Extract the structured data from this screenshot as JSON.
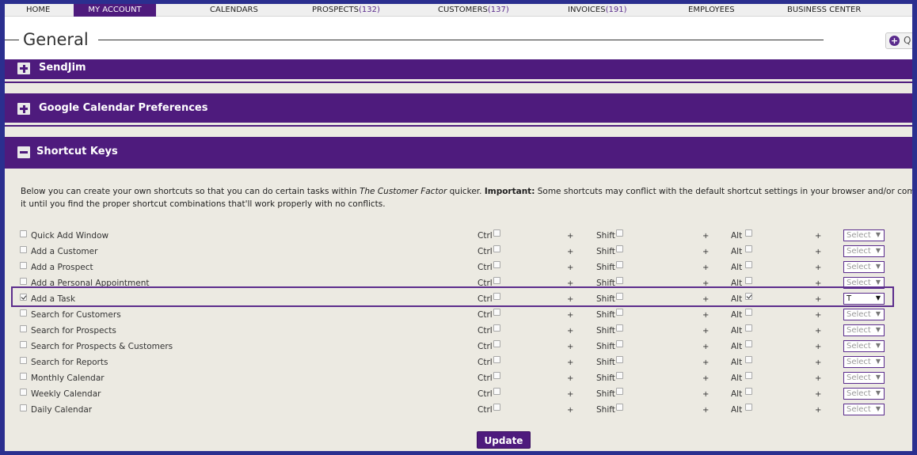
{
  "nav": {
    "home": "HOME",
    "my_account": "MY ACCOUNT",
    "calendars": "CALENDARS",
    "prospects": "PROSPECTS",
    "prospects_count": "(132)",
    "customers": "CUSTOMERS",
    "customers_count": "(137)",
    "invoices": "INVOICES",
    "invoices_count": "(191)",
    "employees": "EMPLOYEES",
    "business_center": "BUSINESS CENTER"
  },
  "header": {
    "title": "General",
    "quick_button_label": "Q"
  },
  "sections": {
    "sendjim": "SendJim",
    "google_calendar": "Google Calendar Preferences",
    "shortcut_keys": "Shortcut Keys"
  },
  "description": {
    "part1": "Below you can create your own shortcuts so that you can do certain tasks within ",
    "brand": "The Customer Factor",
    "part2": " quicker. ",
    "important_label": "Important:",
    "part3": " Some shortcuts may conflict with the default shortcut settings in your browser and/or computer, so it may be nece",
    "line2": "it until you find the proper shortcut combinations that'll work properly with no conflicts."
  },
  "modifiers": {
    "ctrl": "Ctrl",
    "shift": "Shift",
    "alt": "Alt",
    "plus": "+"
  },
  "shortcuts": [
    {
      "label": "Quick Add Window",
      "enabled": false,
      "ctrl": false,
      "shift": false,
      "alt": false,
      "key": "Select"
    },
    {
      "label": "Add a Customer",
      "enabled": false,
      "ctrl": false,
      "shift": false,
      "alt": false,
      "key": "Select"
    },
    {
      "label": "Add a Prospect",
      "enabled": false,
      "ctrl": false,
      "shift": false,
      "alt": false,
      "key": "Select"
    },
    {
      "label": "Add a Personal Appointment",
      "enabled": false,
      "ctrl": false,
      "shift": false,
      "alt": false,
      "key": "Select"
    },
    {
      "label": "Add a Task",
      "enabled": true,
      "ctrl": false,
      "shift": false,
      "alt": true,
      "key": "T"
    },
    {
      "label": "Search for Customers",
      "enabled": false,
      "ctrl": false,
      "shift": false,
      "alt": false,
      "key": "Select"
    },
    {
      "label": "Search for Prospects",
      "enabled": false,
      "ctrl": false,
      "shift": false,
      "alt": false,
      "key": "Select"
    },
    {
      "label": "Search for Prospects & Customers",
      "enabled": false,
      "ctrl": false,
      "shift": false,
      "alt": false,
      "key": "Select"
    },
    {
      "label": "Search for Reports",
      "enabled": false,
      "ctrl": false,
      "shift": false,
      "alt": false,
      "key": "Select"
    },
    {
      "label": "Monthly Calendar",
      "enabled": false,
      "ctrl": false,
      "shift": false,
      "alt": false,
      "key": "Select"
    },
    {
      "label": "Weekly Calendar",
      "enabled": false,
      "ctrl": false,
      "shift": false,
      "alt": false,
      "key": "Select"
    },
    {
      "label": "Daily Calendar",
      "enabled": false,
      "ctrl": false,
      "shift": false,
      "alt": false,
      "key": "Select"
    }
  ],
  "update_button": "Update",
  "colors": {
    "accent": "#4e1b7d",
    "frame": "#2b2f8f",
    "background": "#eceae2"
  }
}
